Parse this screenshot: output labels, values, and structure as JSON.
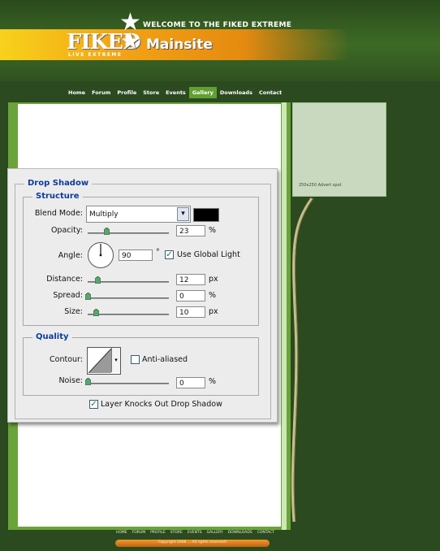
{
  "site": {
    "welcome": "WELCOME TO THE FIKED EXTREME",
    "logo": "FIKED",
    "mainsite": "Mainsite",
    "tagline": "LIVE EXTREME"
  },
  "nav": [
    "Home",
    "Forum",
    "Profile",
    "Store",
    "Events",
    "Gallery",
    "Downloads",
    "Contact"
  ],
  "nav_active": "Gallery",
  "advert": {
    "label": "250x250 Advert spot"
  },
  "dialog": {
    "title": "Drop Shadow",
    "structure": {
      "legend": "Structure",
      "blend_mode_label": "Blend Mode:",
      "blend_mode_value": "Multiply",
      "shadow_color": "#000000",
      "opacity_label": "Opacity:",
      "opacity_value": "23",
      "opacity_unit": "%",
      "angle_label": "Angle:",
      "angle_value": "90",
      "angle_unit": "°",
      "use_global_light_label": "Use Global Light",
      "use_global_light_checked": true,
      "distance_label": "Distance:",
      "distance_value": "12",
      "distance_unit": "px",
      "spread_label": "Spread:",
      "spread_value": "0",
      "spread_unit": "%",
      "size_label": "Size:",
      "size_value": "10",
      "size_unit": "px"
    },
    "quality": {
      "legend": "Quality",
      "contour_label": "Contour:",
      "anti_aliased_label": "Anti-aliased",
      "anti_aliased_checked": false,
      "noise_label": "Noise:",
      "noise_value": "0",
      "noise_unit": "%"
    },
    "layer_knocks_out_label": "Layer Knocks Out Drop Shadow",
    "layer_knocks_out_checked": true
  },
  "footer": {
    "items": [
      "HOME",
      "FORUM",
      "PROFILE",
      "STORE",
      "EVENTS",
      "GALLERY",
      "DOWNLOADS",
      "CONTACT"
    ],
    "copyright": "Copyright 2008 ... All rights reserved!"
  },
  "colors": {
    "background": "#2b4a1f",
    "accent_green": "#6aa33a",
    "nav_active": "#5fa131",
    "dialog_legend": "#0a3c9c",
    "header_orange": "#f2a314"
  }
}
